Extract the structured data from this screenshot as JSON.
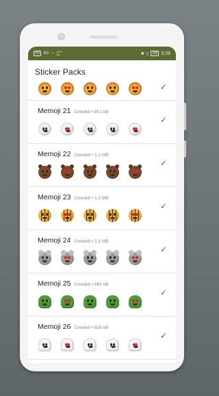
{
  "status_bar": {
    "left": [
      "HD",
      "4G",
      "37%",
      "8/s"
    ],
    "right_icons": [
      "bluetooth-icon",
      "vibrate-icon",
      "battery-icon"
    ],
    "battery": "100",
    "time": "5:28",
    "bar_color": "#5d6a34"
  },
  "header": {
    "title": "Sticker Packs"
  },
  "packs": [
    {
      "name": "",
      "author": "",
      "size": "",
      "kind": "lion",
      "added": true
    },
    {
      "name": "Memoji 21",
      "author": "Crewlett",
      "size": "801 kB",
      "kind": "skull",
      "added": true
    },
    {
      "name": "Memoji 22",
      "author": "Crewlett",
      "size": "1.1 MB",
      "kind": "bear",
      "added": true
    },
    {
      "name": "Memoji 23",
      "author": "Crewlett",
      "size": "1.2 MB",
      "kind": "tiger",
      "added": true
    },
    {
      "name": "Memoji 24",
      "author": "Crewlett",
      "size": "1.1 MB",
      "kind": "koala",
      "added": true
    },
    {
      "name": "Memoji 25",
      "author": "Crewlett",
      "size": "885 kB",
      "kind": "cactus",
      "added": true
    },
    {
      "name": "Memoji 26",
      "author": "Crewlett",
      "size": "825 kB",
      "kind": "ghost",
      "added": true
    }
  ],
  "check_glyph": "✓",
  "meta_separator": " • ",
  "accent_color": "#5d6a34"
}
